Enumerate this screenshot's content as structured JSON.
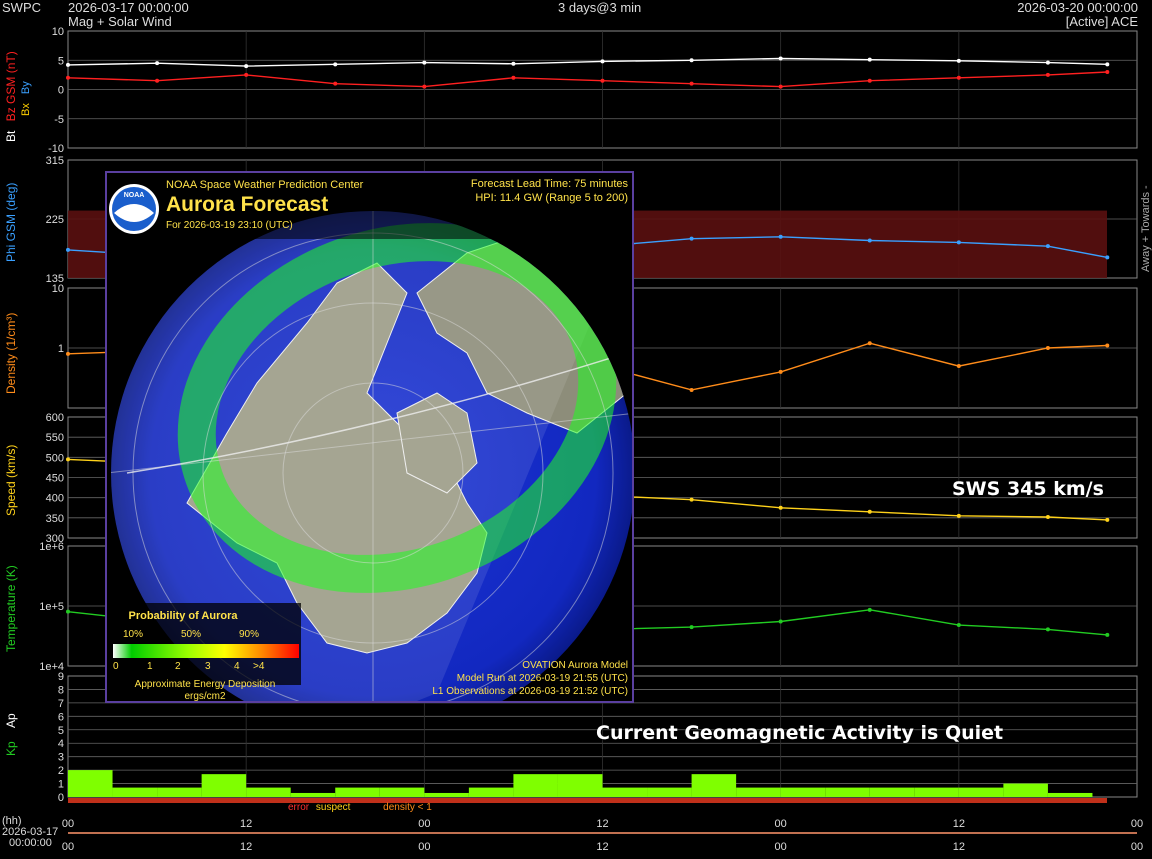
{
  "header": {
    "org": "SWPC",
    "start_time": "2026-03-17 00:00:00",
    "subtitle": "Mag + Solar Wind",
    "range": "3 days@3 min",
    "end_time": "2026-03-20 00:00:00",
    "source": "[Active] ACE"
  },
  "colors": {
    "bt": "#ffffff",
    "bz": "#ff2020",
    "bx": "#ffd000",
    "by": "#3aa0ff",
    "phi": "#3aa0ff",
    "density": "#ff8c1a",
    "speed": "#ffd21a",
    "temperature": "#22cc22",
    "kp": "#7fff00",
    "grid": "#666666"
  },
  "chart_data": [
    {
      "type": "line",
      "panel": "mag",
      "ylabel_parts": [
        "Bt",
        "Bz GSM (nT)",
        "Bx",
        "By"
      ],
      "yticks": [
        "10",
        "5",
        "0",
        "-5",
        "-10"
      ],
      "ylim": [
        -10,
        10
      ],
      "x_hours": [
        0,
        6,
        12,
        18,
        24,
        30,
        36,
        42,
        48,
        54,
        60,
        66,
        70
      ],
      "series": [
        {
          "name": "Bt",
          "values": [
            4.2,
            4.5,
            4.0,
            4.3,
            4.6,
            4.4,
            4.8,
            5.0,
            5.3,
            5.1,
            4.9,
            4.6,
            4.3
          ]
        },
        {
          "name": "Bz",
          "values": [
            2.0,
            1.5,
            2.5,
            1.0,
            0.5,
            2.0,
            1.5,
            1.0,
            0.5,
            1.5,
            2.0,
            2.5,
            3.0
          ]
        }
      ]
    },
    {
      "type": "scatter",
      "panel": "phi",
      "ylabel": "Phi GSM (deg)",
      "right_label": "Away +  Towards -",
      "yticks": [
        "315",
        "225",
        "135"
      ],
      "ylim": [
        45,
        360
      ],
      "x_hours": [
        0,
        6,
        12,
        18,
        24,
        30,
        36,
        42,
        48,
        54,
        60,
        66,
        70
      ],
      "values": [
        120,
        105,
        140,
        130,
        125,
        135,
        130,
        150,
        155,
        145,
        140,
        130,
        100
      ]
    },
    {
      "type": "line",
      "panel": "density",
      "ylabel": "Density (1/cm³)",
      "yticks": [
        "10",
        "1",
        ""
      ],
      "scale": "log",
      "ylim": [
        0.1,
        10
      ],
      "x_hours": [
        0,
        6,
        12,
        18,
        24,
        30,
        36,
        42,
        48,
        54,
        60,
        66,
        70
      ],
      "values": [
        0.8,
        0.9,
        0.7,
        0.6,
        0.7,
        0.8,
        0.5,
        0.2,
        0.4,
        1.2,
        0.5,
        1.0,
        1.1
      ]
    },
    {
      "type": "line",
      "panel": "speed",
      "ylabel": "Speed (km/s)",
      "yticks": [
        "600",
        "550",
        "500",
        "450",
        "400",
        "350",
        "300"
      ],
      "ylim": [
        300,
        600
      ],
      "x_hours": [
        0,
        6,
        12,
        18,
        24,
        30,
        36,
        42,
        48,
        54,
        60,
        66,
        70
      ],
      "values": [
        495,
        485,
        470,
        450,
        430,
        415,
        405,
        395,
        375,
        365,
        355,
        352,
        345
      ]
    },
    {
      "type": "line",
      "panel": "temperature",
      "ylabel": "Temperature (K)",
      "yticks": [
        "1e+6",
        "1e+5",
        "1e+4"
      ],
      "scale": "log",
      "ylim": [
        6000,
        3000000
      ],
      "x_hours": [
        0,
        6,
        12,
        18,
        24,
        30,
        36,
        42,
        48,
        54,
        60,
        66,
        70
      ],
      "values": [
        100000,
        60000,
        50000,
        45000,
        40000,
        35000,
        40000,
        45000,
        60000,
        110000,
        50000,
        40000,
        30000
      ]
    },
    {
      "type": "bar",
      "panel": "kp",
      "ylabel_parts": [
        "Kp",
        "Ap"
      ],
      "yticks": [
        "9",
        "8",
        "7",
        "6",
        "5",
        "4",
        "3",
        "2",
        "1",
        "0"
      ],
      "ylim": [
        0,
        9
      ],
      "x_start_hours": [
        0,
        3,
        6,
        9,
        12,
        15,
        18,
        21,
        24,
        27,
        30,
        33,
        36,
        39,
        42,
        45,
        48,
        51,
        54,
        57,
        60,
        63,
        66,
        69
      ],
      "values": [
        2.0,
        0.7,
        0.7,
        1.7,
        0.7,
        0.3,
        0.7,
        0.7,
        0.3,
        0.7,
        1.7,
        1.7,
        0.7,
        0.7,
        1.7,
        0.7,
        0.7,
        0.7,
        0.7,
        0.7,
        0.7,
        1.0,
        0.3,
        0.0
      ]
    }
  ],
  "legend_flags": {
    "error": "error",
    "suspect": "suspect",
    "density": "density < 1"
  },
  "x_axis": {
    "hh_label": "(hh)",
    "date_label": "2026-03-17",
    "time_label": "00:00:00",
    "ticks": [
      "00",
      "12",
      "00",
      "12",
      "00",
      "12",
      "00"
    ]
  },
  "aurora": {
    "org": "NOAA Space Weather Prediction Center",
    "title": "Aurora Forecast",
    "for_time": "For 2026-03-19 23:10 (UTC)",
    "lead_time": "Forecast Lead Time:  75 minutes",
    "hpi": "HPI:  11.4 GW (Range 5 to 200)",
    "prob_title": "Probability of Aurora",
    "prob_ticks": [
      "10%",
      "50%",
      "90%"
    ],
    "energy_ticks": [
      "0",
      "1",
      "2",
      "3",
      "4",
      ">4"
    ],
    "energy_caption": "Approximate Energy Deposition",
    "energy_units": "ergs/cm2",
    "model": "OVATION Aurora Model",
    "model_run": "Model Run at 2026-03-19 21:55 (UTC)",
    "l1_obs": "L1 Observations at 2026-03-19 21:52 (UTC)",
    "logo_text": "NOAA"
  },
  "overlays": {
    "sws": "SWS 345 km/s",
    "activity": "Current Geomagnetic Activity is Quiet"
  }
}
